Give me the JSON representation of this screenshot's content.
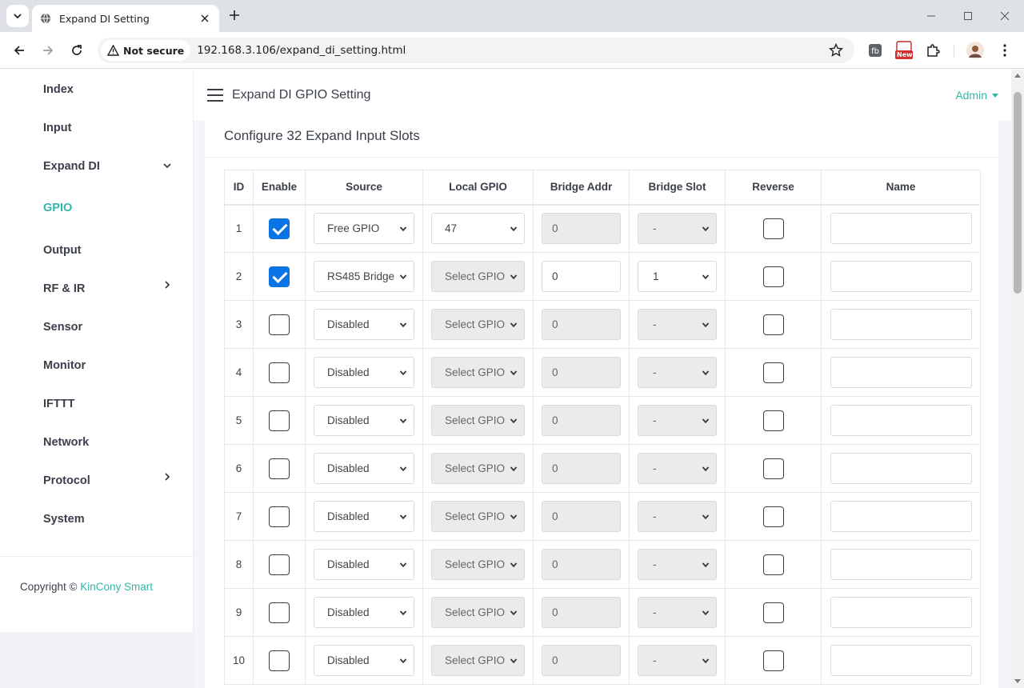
{
  "browser": {
    "tab_title": "Expand DI Setting",
    "security_label": "Not secure",
    "url": "192.168.3.106/expand_di_setting.html",
    "extension_badge": "New"
  },
  "sidebar": {
    "items": [
      {
        "label": "Index"
      },
      {
        "label": "Input"
      },
      {
        "label": "Expand DI"
      },
      {
        "label": "GPIO"
      },
      {
        "label": "Output"
      },
      {
        "label": "RF & IR"
      },
      {
        "label": "Sensor"
      },
      {
        "label": "Monitor"
      },
      {
        "label": "IFTTT"
      },
      {
        "label": "Network"
      },
      {
        "label": "Protocol"
      },
      {
        "label": "System"
      }
    ],
    "copyright_prefix": "Copyright ©",
    "copyright_brand": "KinCony Smart"
  },
  "header": {
    "title": "Expand DI GPIO Setting",
    "user": "Admin"
  },
  "card": {
    "title": "Configure 32 Expand Input Slots"
  },
  "table": {
    "columns": [
      "ID",
      "Enable",
      "Source",
      "Local GPIO",
      "Bridge Addr",
      "Bridge Slot",
      "Reverse",
      "Name"
    ],
    "rows": [
      {
        "id": "1",
        "source": "Free GPIO",
        "local_gpio": "47",
        "bridge_addr": "0",
        "bridge_slot": "-",
        "name": ""
      },
      {
        "id": "2",
        "source": "RS485 Bridge",
        "local_gpio": "Select GPIO",
        "bridge_addr": "0",
        "bridge_slot": "1",
        "name": ""
      },
      {
        "id": "3",
        "source": "Disabled",
        "local_gpio": "Select GPIO",
        "bridge_addr": "0",
        "bridge_slot": "-",
        "name": ""
      },
      {
        "id": "4",
        "source": "Disabled",
        "local_gpio": "Select GPIO",
        "bridge_addr": "0",
        "bridge_slot": "-",
        "name": ""
      },
      {
        "id": "5",
        "source": "Disabled",
        "local_gpio": "Select GPIO",
        "bridge_addr": "0",
        "bridge_slot": "-",
        "name": ""
      },
      {
        "id": "6",
        "source": "Disabled",
        "local_gpio": "Select GPIO",
        "bridge_addr": "0",
        "bridge_slot": "-",
        "name": ""
      },
      {
        "id": "7",
        "source": "Disabled",
        "local_gpio": "Select GPIO",
        "bridge_addr": "0",
        "bridge_slot": "-",
        "name": ""
      },
      {
        "id": "8",
        "source": "Disabled",
        "local_gpio": "Select GPIO",
        "bridge_addr": "0",
        "bridge_slot": "-",
        "name": ""
      },
      {
        "id": "9",
        "source": "Disabled",
        "local_gpio": "Select GPIO",
        "bridge_addr": "0",
        "bridge_slot": "-",
        "name": ""
      },
      {
        "id": "10",
        "source": "Disabled",
        "local_gpio": "Select GPIO",
        "bridge_addr": "0",
        "bridge_slot": "-",
        "name": ""
      }
    ]
  },
  "colors": {
    "accent": "#33b5a8",
    "checkbox_checked": "#0b74e5"
  }
}
